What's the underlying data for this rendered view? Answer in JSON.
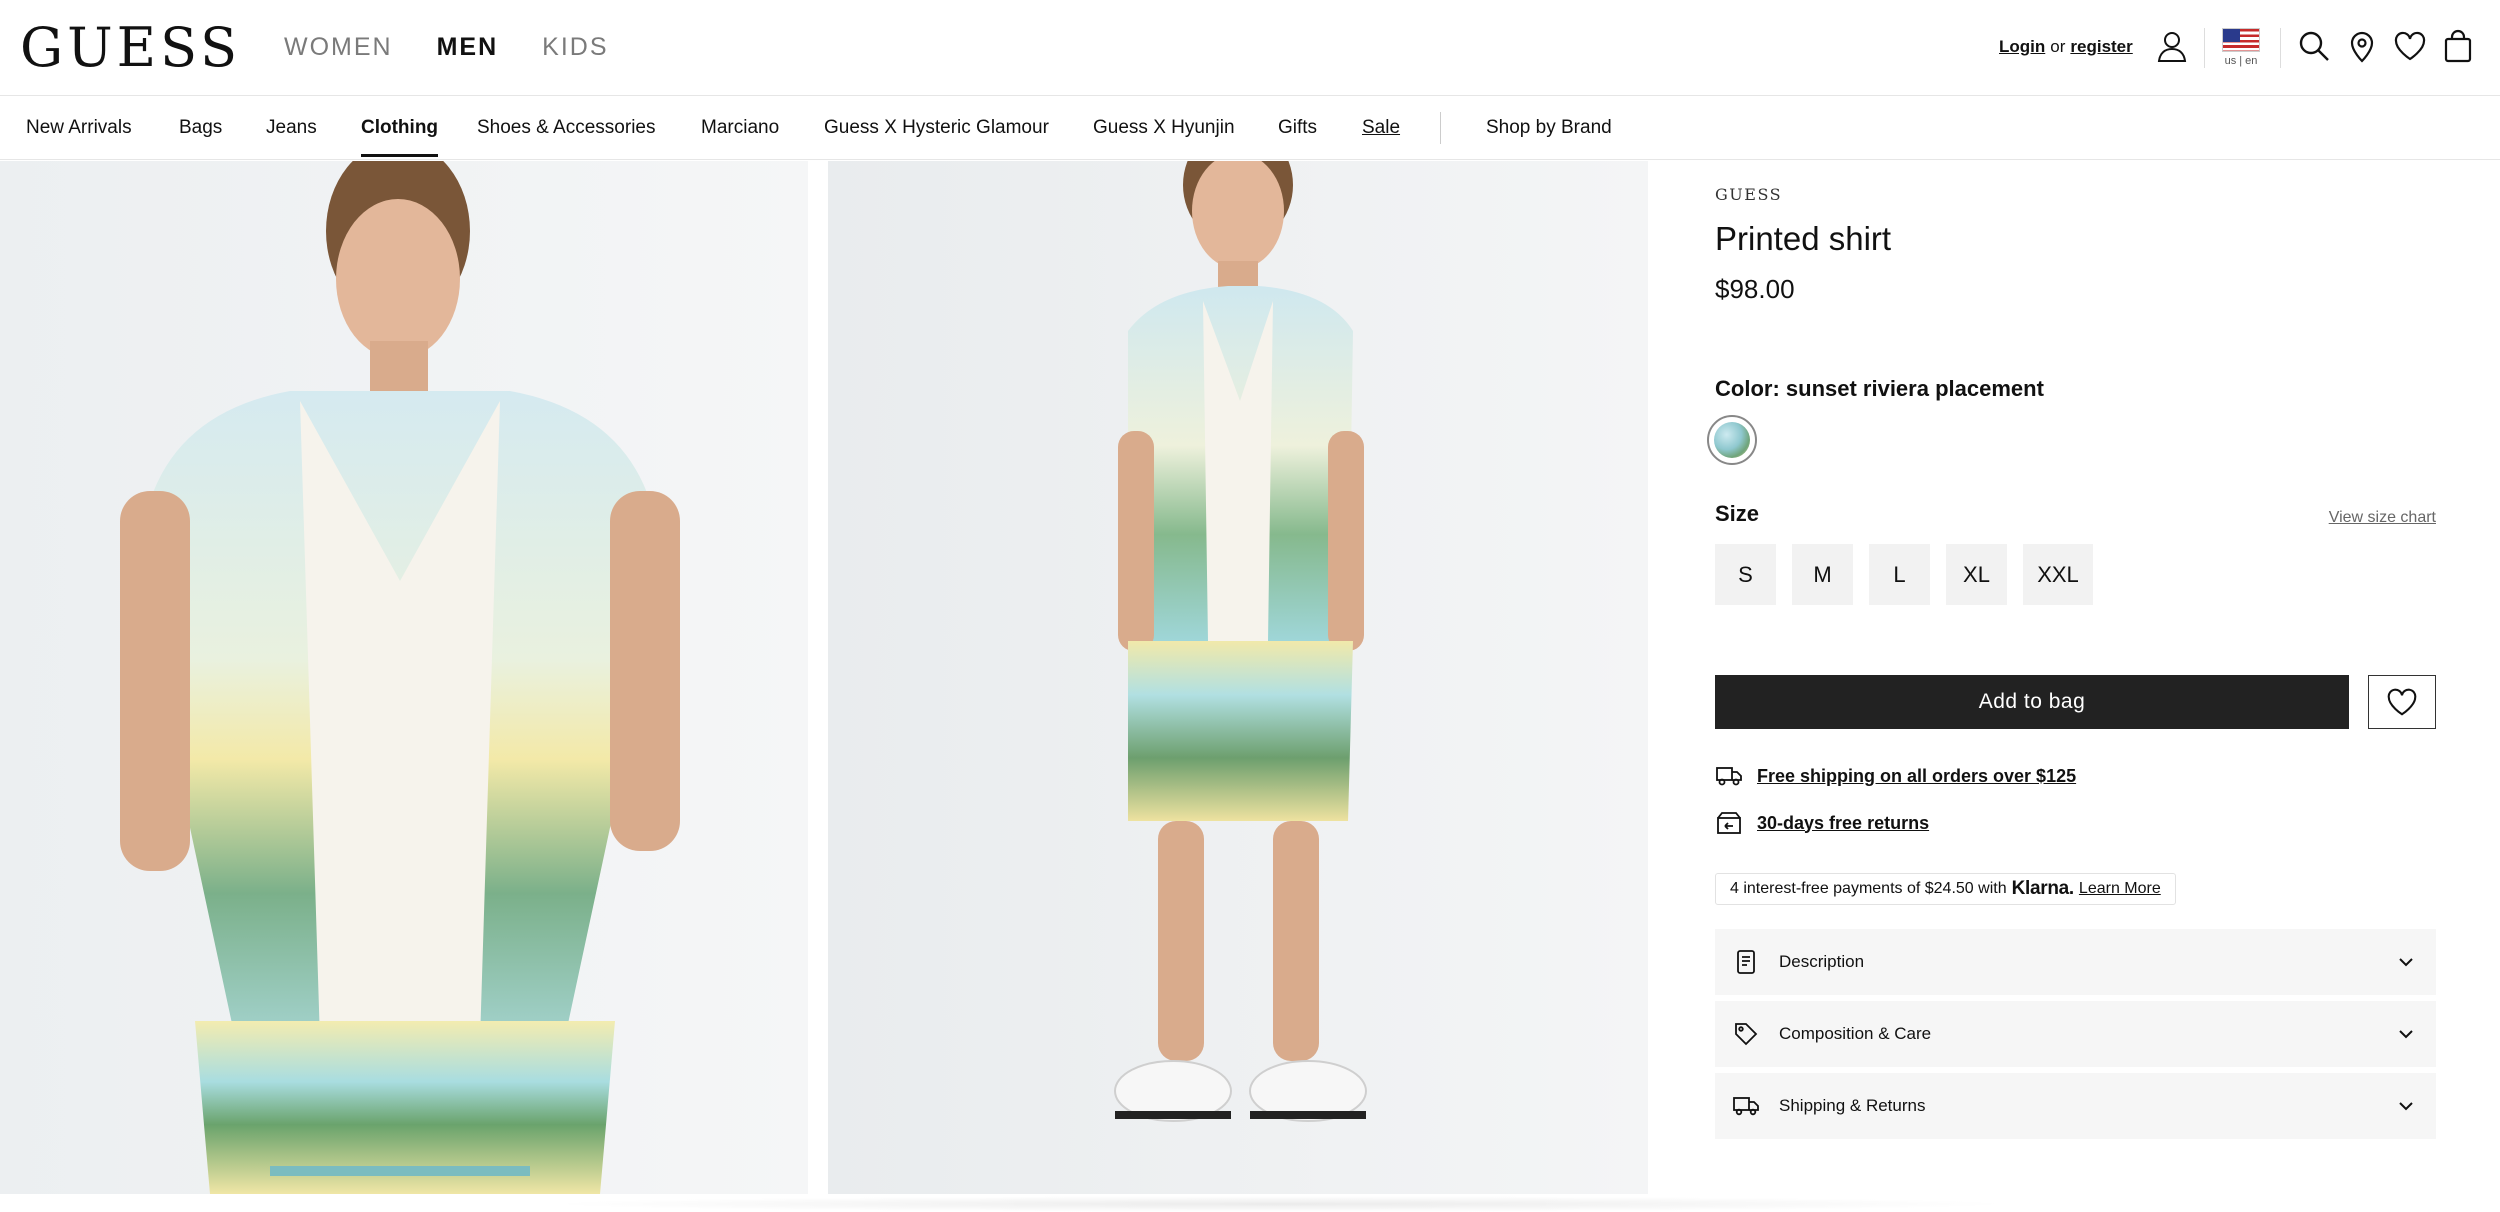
{
  "header": {
    "logo": "GUESS",
    "gender_tabs": [
      {
        "label": "WOMEN",
        "active": false
      },
      {
        "label": "MEN",
        "active": true
      },
      {
        "label": "KIDS",
        "active": false
      }
    ],
    "account": {
      "login": "Login",
      "or": "or",
      "register": "register"
    },
    "locale": "us | en",
    "icons": [
      "user-icon",
      "flag-icon",
      "search-icon",
      "location-icon",
      "heart-icon",
      "bag-icon"
    ]
  },
  "category_nav": {
    "items": [
      {
        "label": "New Arrivals"
      },
      {
        "label": "Bags"
      },
      {
        "label": "Jeans"
      },
      {
        "label": "Clothing",
        "active": true
      },
      {
        "label": "Shoes & Accessories"
      },
      {
        "label": "Marciano"
      },
      {
        "label": "Guess X Hysteric Glamour"
      },
      {
        "label": "Guess X Hyunjin"
      },
      {
        "label": "Gifts"
      },
      {
        "label": "Sale"
      }
    ],
    "shop_by_brand": "Shop by Brand"
  },
  "product": {
    "brand": "GUESS",
    "name": "Printed shirt",
    "price": "$98.00",
    "color_label": "Color:",
    "color_value": "sunset riviera placement",
    "size_label": "Size",
    "size_chart": "View size chart",
    "sizes": [
      "S",
      "M",
      "L",
      "XL",
      "XXL"
    ],
    "add_to_bag": "Add to bag",
    "perks": {
      "shipping": "Free shipping on all orders over $125",
      "returns": "30-days free returns"
    },
    "klarna": {
      "text": "4 interest-free payments of $24.50 with",
      "brand": "Klarna.",
      "learn_more": "Learn More"
    },
    "accordions": [
      {
        "label": "Description",
        "icon": "document-icon"
      },
      {
        "label": "Composition & Care",
        "icon": "tag-icon"
      },
      {
        "label": "Shipping & Returns",
        "icon": "truck-icon"
      }
    ]
  },
  "colors": {
    "text": "#111111",
    "button_dark": "#222222",
    "size_bg": "#f2f2f2",
    "accordion_bg": "#f6f6f6",
    "muted": "#7a7a7a"
  }
}
